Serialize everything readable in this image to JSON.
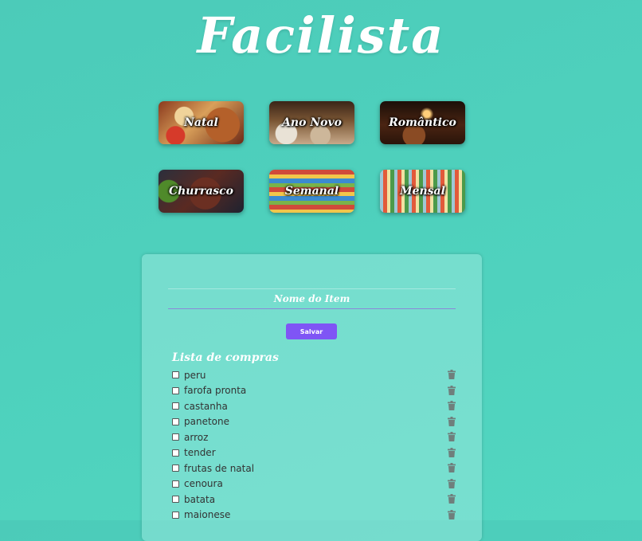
{
  "app": {
    "title": "Facilista"
  },
  "categories": [
    {
      "label": "Natal"
    },
    {
      "label": "Ano Novo"
    },
    {
      "label": "Romântico"
    },
    {
      "label": "Churrasco"
    },
    {
      "label": "Semanal"
    },
    {
      "label": "Mensal"
    }
  ],
  "form": {
    "item_value": "",
    "item_placeholder": "Nome do Item",
    "save_label": "Salvar"
  },
  "list": {
    "title": "Lista de compras",
    "items": [
      {
        "text": "peru",
        "checked": false
      },
      {
        "text": "farofa pronta",
        "checked": false
      },
      {
        "text": "castanha",
        "checked": false
      },
      {
        "text": "panetone",
        "checked": false
      },
      {
        "text": "arroz",
        "checked": false
      },
      {
        "text": "tender",
        "checked": false
      },
      {
        "text": "frutas de natal",
        "checked": false
      },
      {
        "text": "cenoura",
        "checked": false
      },
      {
        "text": "batata",
        "checked": false
      },
      {
        "text": "maionese",
        "checked": false
      }
    ]
  },
  "icons": {
    "delete": "trash-icon"
  },
  "colors": {
    "background": "#4ecfbb",
    "accent": "#7f55f5",
    "trash": "#6f7f7c"
  }
}
